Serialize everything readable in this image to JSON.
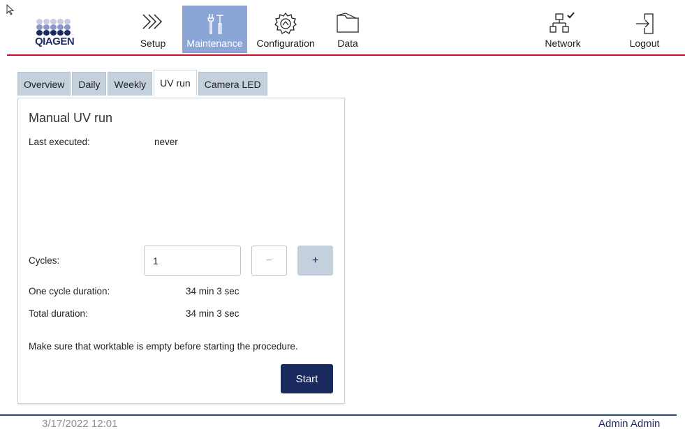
{
  "brand": {
    "name": "QIAGEN"
  },
  "nav": {
    "setup": "Setup",
    "maintenance": "Maintenance",
    "configuration": "Configuration",
    "data": "Data",
    "network": "Network",
    "logout": "Logout"
  },
  "tabs": {
    "overview": "Overview",
    "daily": "Daily",
    "weekly": "Weekly",
    "uv_run": "UV run",
    "camera_led": "Camera LED"
  },
  "panel": {
    "title": "Manual UV run",
    "last_executed_label": "Last executed:",
    "last_executed_value": "never",
    "cycles_label": "Cycles:",
    "cycles_value": "1",
    "minus_label": "−",
    "plus_label": "+",
    "cycle_duration_label": "One cycle duration:",
    "cycle_duration_value": "34 min 3 sec",
    "total_duration_label": "Total duration:",
    "total_duration_value": "34 min 3 sec",
    "notice": "Make sure that worktable is empty before starting the procedure.",
    "start_label": "Start"
  },
  "footer": {
    "datetime": "3/17/2022 12:01",
    "user": "Admin Admin"
  },
  "colors": {
    "brand_red": "#c8102e",
    "navy": "#1b2a5e",
    "active_nav": "#8ba6d6",
    "tab_inactive": "#c5d0dd"
  }
}
